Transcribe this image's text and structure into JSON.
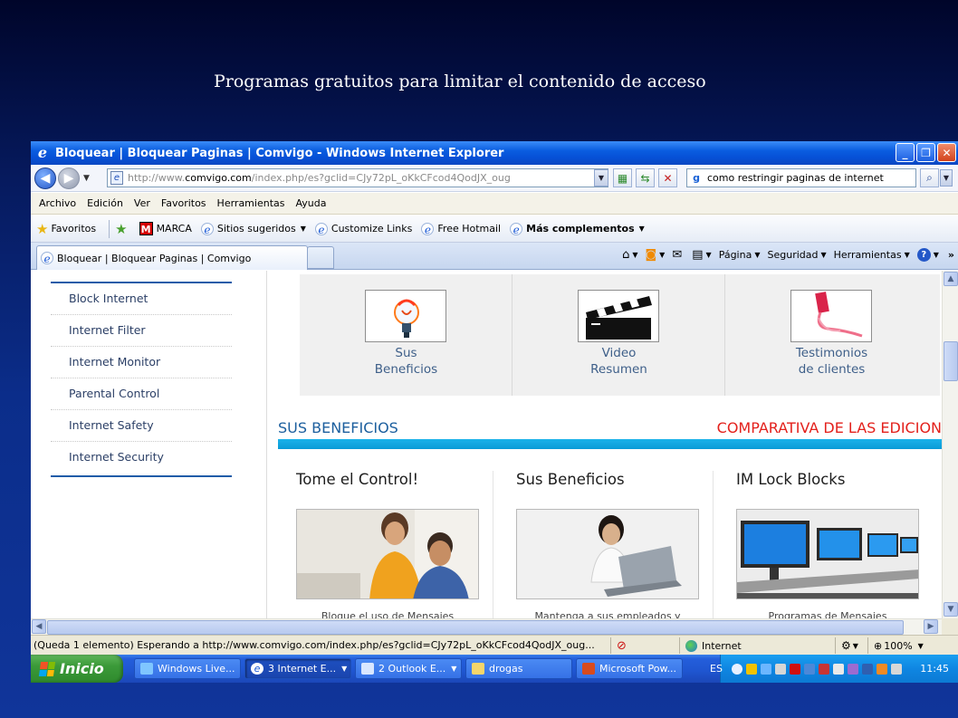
{
  "slide": {
    "title": "Programas gratuitos para limitar el contenido de acceso"
  },
  "window": {
    "title": "Bloquear | Bloquear Paginas | Comvigo - Windows Internet Explorer"
  },
  "address_bar": {
    "url_prefix": "http://www.",
    "url_domain": "comvigo.com",
    "url_rest": "/index.php/es?gclid=CJy72pL_oKkCFcod4QodJX_oug",
    "search_value": "como restringir paginas de internet"
  },
  "menu": [
    "Archivo",
    "Edición",
    "Ver",
    "Favoritos",
    "Herramientas",
    "Ayuda"
  ],
  "favorites_bar": {
    "favorites_label": "Favoritos",
    "items": [
      "MARCA",
      "Sitios sugeridos",
      "Customize Links",
      "Free Hotmail",
      "Más complementos"
    ]
  },
  "tab": {
    "label": "Bloquear | Bloquear Paginas | Comvigo"
  },
  "command_bar": {
    "page": "Página",
    "security": "Seguridad",
    "tools": "Herramientas",
    "more": "»"
  },
  "sidebar": {
    "items": [
      "Block Internet",
      "Internet Filter",
      "Internet Monitor",
      "Parental Control",
      "Internet Safety",
      "Internet Security"
    ]
  },
  "tiles": [
    {
      "line1": "Sus",
      "line2": "Beneficios",
      "image": "lightbulb-image"
    },
    {
      "line1": "Video",
      "line2": "Resumen",
      "image": "clapperboard-image"
    },
    {
      "line1": "Testimonios",
      "line2": "de clientes",
      "image": "pen-image"
    }
  ],
  "section": {
    "left": "SUS BENEFICIOS",
    "right": "COMPARATIVA DE LAS EDICION"
  },
  "columns": [
    {
      "title": "Tome el Control!",
      "caption": "Bloque el uso de Mensajes"
    },
    {
      "title": "Sus Beneficios",
      "caption": "Mantenga a sus empleados y"
    },
    {
      "title": "IM Lock Blocks",
      "caption": "Programas de Mensajes"
    }
  ],
  "status_bar": {
    "text": "(Queda 1 elemento) Esperando a http://www.comvigo.com/index.php/es?gclid=CJy72pL_oKkCFcod4QodJX_oug...",
    "zone": "Internet",
    "zoom": "100%"
  },
  "taskbar": {
    "start": "Inicio",
    "tasks": [
      "Windows Live...",
      "3 Internet E...",
      "2 Outlook E...",
      "drogas",
      "Microsoft Pow..."
    ],
    "language": "ES",
    "clock": "11:45"
  },
  "colors": {
    "section_blue": "#1c5f9e",
    "section_red": "#e3211c",
    "band": "#0a9ad6",
    "xp_blue": "#245edb",
    "start_green": "#3b9a39"
  }
}
